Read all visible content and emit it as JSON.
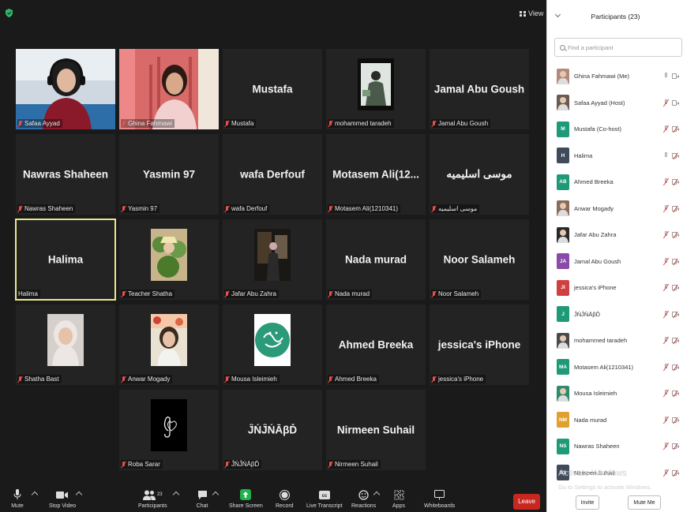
{
  "meeting": {
    "view_label": "View",
    "tiles": [
      {
        "id": "safaa",
        "name": "",
        "label": "Safaa Ayyad",
        "type": "video-woman-headset"
      },
      {
        "id": "ghina",
        "name": "",
        "label": "Ghina Fahmawi",
        "type": "video-woman-red"
      },
      {
        "id": "mustafa",
        "name": "Mustafa",
        "label": "Mustafa",
        "type": "name"
      },
      {
        "id": "mohammed",
        "name": "",
        "label": "mohammed taradeh",
        "type": "thumb-man"
      },
      {
        "id": "jamal",
        "name": "Jamal Abu Goush",
        "label": "Jamal Abu Goush",
        "type": "name"
      },
      {
        "id": "nawras",
        "name": "Nawras Shaheen",
        "label": "Nawras Shaheen",
        "type": "name"
      },
      {
        "id": "yasmin",
        "name": "Yasmin 97",
        "label": "Yasmin 97",
        "type": "name"
      },
      {
        "id": "wafa",
        "name": "wafa Derfouf",
        "label": "wafa Derfouf",
        "type": "name"
      },
      {
        "id": "motasem",
        "name": "Motasem  Ali(12...",
        "label": "Motasem Ali(1210341)",
        "type": "name"
      },
      {
        "id": "musa",
        "name": "موسى اسليميه",
        "label": "موسى اسليميه",
        "type": "name"
      },
      {
        "id": "halima",
        "name": "Halima",
        "label": "Halima",
        "type": "name",
        "active": true
      },
      {
        "id": "teacher",
        "name": "",
        "label": "Teacher Shatha",
        "type": "thumb-plant"
      },
      {
        "id": "jafar",
        "name": "",
        "label": "Jafar Abu Zahra",
        "type": "thumb-dark"
      },
      {
        "id": "nada",
        "name": "Nada murad",
        "label": "Nada murad",
        "type": "name"
      },
      {
        "id": "noor",
        "name": "Noor Salameh",
        "label": "Noor Salameh",
        "type": "name"
      },
      {
        "id": "shatha",
        "name": "",
        "label": "Shatha Bast",
        "type": "thumb-hijab"
      },
      {
        "id": "anwar",
        "name": "",
        "label": "Anwar Mogady",
        "type": "thumb-girl"
      },
      {
        "id": "mousa",
        "name": "",
        "label": "Mousa Isleimieh",
        "type": "thumb-calligraphy"
      },
      {
        "id": "ahmed",
        "name": "Ahmed Breeka",
        "label": "Ahmed Breeka",
        "type": "name"
      },
      {
        "id": "jessica",
        "name": "jessica's iPhone",
        "label": "jessica's iPhone",
        "type": "name"
      },
      {
        "id": "roba",
        "name": "",
        "label": "Roba Sarar",
        "type": "thumb-music"
      },
      {
        "id": "jn",
        "name": "ĴŃĴŃĀβĎ",
        "label": "ĴŃĴŃĀβĎ",
        "type": "name"
      },
      {
        "id": "nirmeen",
        "name": "Nirmeen Suhail",
        "label": "Nirmeen Suhail",
        "type": "name"
      }
    ]
  },
  "toolbar": {
    "mute": "Mute",
    "stop_video": "Stop Video",
    "participants": "Participants",
    "participants_count": "23",
    "chat": "Chat",
    "share_screen": "Share Screen",
    "record": "Record",
    "live_transcript": "Live Transcript",
    "reactions": "Reactions",
    "apps": "Apps",
    "whiteboards": "Whiteboards",
    "leave": "Leave"
  },
  "panel": {
    "title": "Participants (23)",
    "search_placeholder": "Find a participant",
    "participants": [
      {
        "name": "Ghina Fahmawi (Me)",
        "initials": "",
        "color": "#b08a7a",
        "mic": "on",
        "cam": "on",
        "photo": true
      },
      {
        "name": "Safaa Ayyad (Host)",
        "initials": "",
        "color": "#6b5a52",
        "mic": "off",
        "cam": "on",
        "photo": true
      },
      {
        "name": "Mustafa (Co-host)",
        "initials": "M",
        "color": "#1f9a78",
        "mic": "off",
        "cam": "off"
      },
      {
        "name": "Halima",
        "initials": "H",
        "color": "#3f4a5a",
        "mic": "on",
        "cam": "off"
      },
      {
        "name": "Ahmed Breeka",
        "initials": "AB",
        "color": "#1f9a78",
        "mic": "off",
        "cam": "off"
      },
      {
        "name": "Anwar Mogady",
        "initials": "",
        "color": "#8a6a5a",
        "mic": "off",
        "cam": "off",
        "photo": true
      },
      {
        "name": "Jafar Abu Zahra",
        "initials": "",
        "color": "#2a2a2a",
        "mic": "off",
        "cam": "off",
        "photo": true
      },
      {
        "name": "Jamal Abu Goush",
        "initials": "JA",
        "color": "#8a4aa8",
        "mic": "off",
        "cam": "off"
      },
      {
        "name": "jessica's iPhone",
        "initials": "JI",
        "color": "#d04040",
        "mic": "off",
        "cam": "off"
      },
      {
        "name": "ĴŃĴŃĀβĎ",
        "initials": "J",
        "color": "#1f9a78",
        "mic": "off",
        "cam": "off"
      },
      {
        "name": "mohammed taradeh",
        "initials": "",
        "color": "#4a4a4a",
        "mic": "off",
        "cam": "off",
        "photo": true
      },
      {
        "name": "Motasem Ali(1210341)",
        "initials": "MA",
        "color": "#1f9a78",
        "mic": "off",
        "cam": "off"
      },
      {
        "name": "Mousa Isleimieh",
        "initials": "",
        "color": "#2e8a6a",
        "mic": "off",
        "cam": "off",
        "photo": true
      },
      {
        "name": "Nada murad",
        "initials": "NM",
        "color": "#e0a030",
        "mic": "off",
        "cam": "off"
      },
      {
        "name": "Nawras Shaheen",
        "initials": "NS",
        "color": "#1f9a78",
        "mic": "off",
        "cam": "off"
      },
      {
        "name": "Nirmeen Suhail",
        "initials": "NS",
        "color": "#3f4a5a",
        "mic": "off",
        "cam": "off"
      }
    ],
    "watermark_title": "Activate Windows",
    "watermark_sub": "Go to Settings to activate Windows.",
    "invite": "Invite",
    "mute_me": "Mute Me"
  }
}
